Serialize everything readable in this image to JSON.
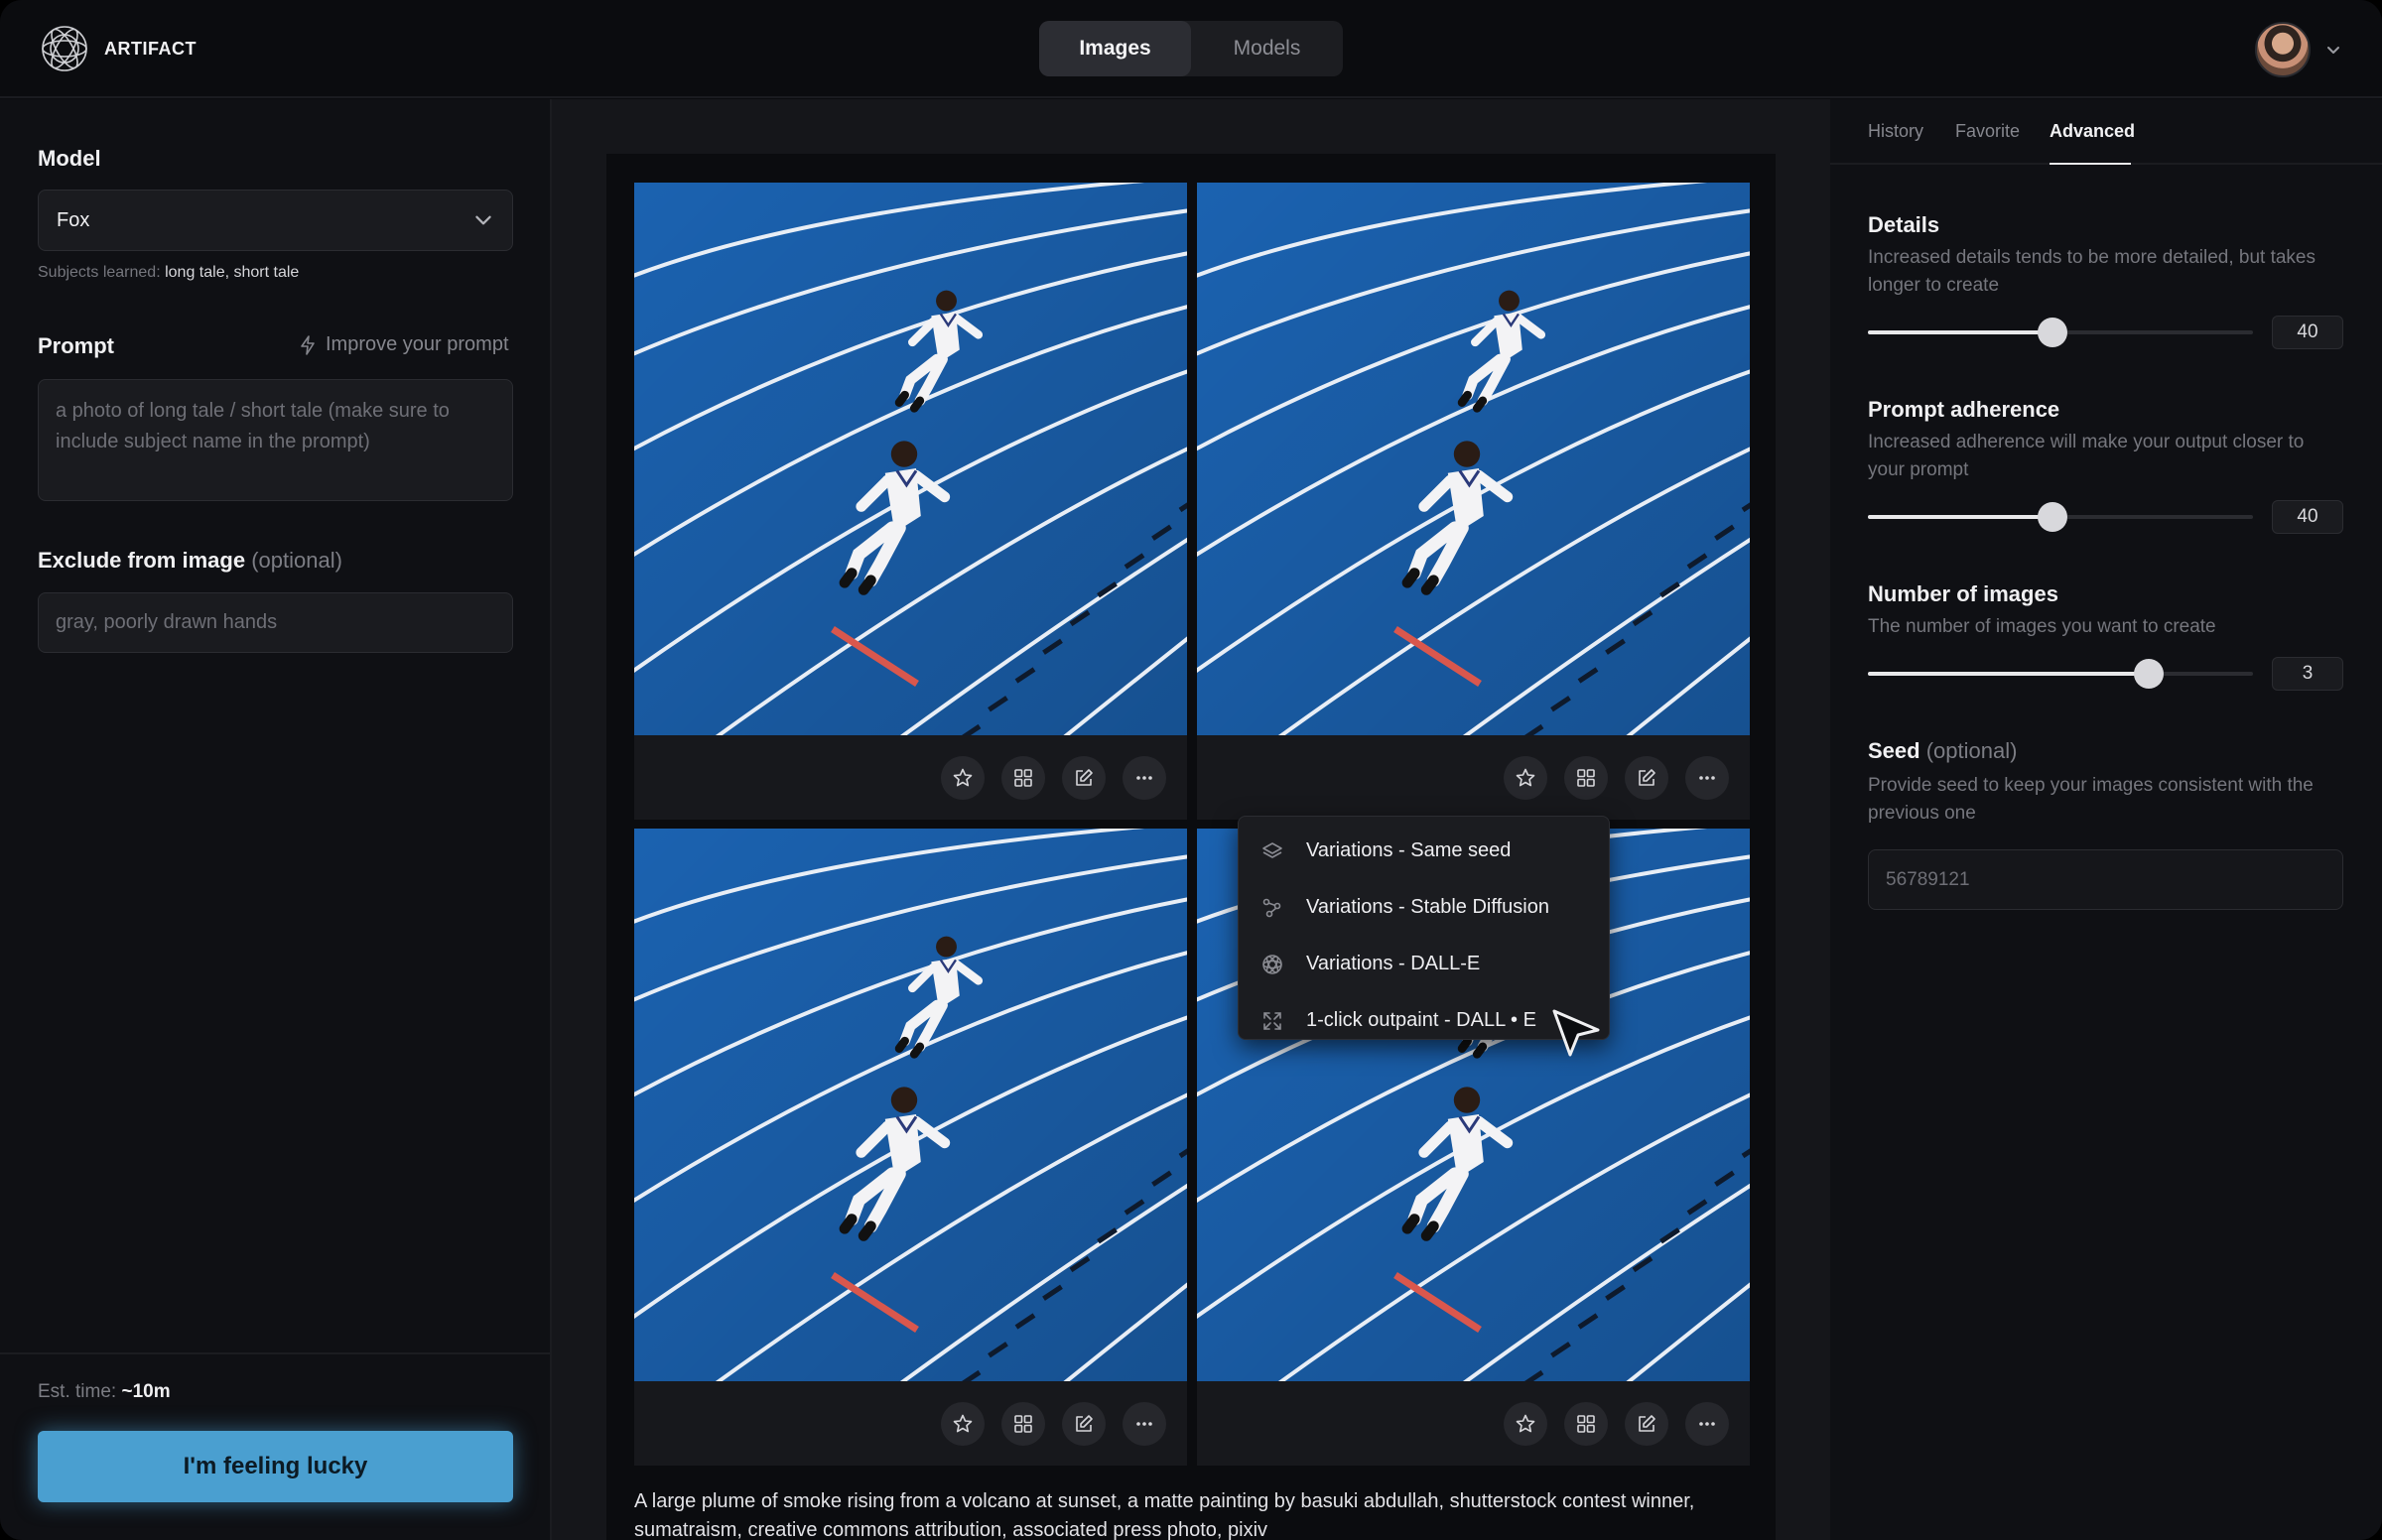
{
  "app": {
    "brand": "ARTIFACT"
  },
  "header": {
    "tabs": [
      {
        "label": "Images",
        "active": true
      },
      {
        "label": "Models",
        "active": false
      }
    ]
  },
  "sidebar": {
    "model_label": "Model",
    "model_value": "Fox",
    "subjects_prefix": "Subjects learned:",
    "subjects_value": "long tale, short tale",
    "prompt_label": "Prompt",
    "improve_label": "Improve your prompt",
    "prompt_placeholder": "a photo of long tale / short tale (make sure to include subject name in the prompt)",
    "exclude_label": "Exclude from image",
    "exclude_optional": "(optional)",
    "exclude_placeholder": "gray, poorly drawn hands",
    "est_prefix": "Est. time:",
    "est_value": "~10m",
    "lucky_button": "I'm feeling lucky"
  },
  "gallery": {
    "caption": "A large plume of smoke rising from a volcano at sunset, a matte painting by basuki abdullah, shutterstock contest winner, sumatraism, creative commons attribution, associated press photo, pixiv",
    "image_actions": [
      "star-icon",
      "grid-icon",
      "edit-icon",
      "more-icon"
    ],
    "menu_items": [
      {
        "label": "Variations - Same seed",
        "icon": "layers-icon"
      },
      {
        "label": "Variations - Stable Diffusion",
        "icon": "nodes-icon"
      },
      {
        "label": "Variations - DALL-E",
        "icon": "openai-icon"
      },
      {
        "label": "1-click outpaint - DALL • E",
        "icon": "expand-icon"
      }
    ]
  },
  "right_panel": {
    "tabs": [
      {
        "label": "History",
        "active": false
      },
      {
        "label": "Favorite",
        "active": false
      },
      {
        "label": "Advanced",
        "active": true
      }
    ],
    "details": {
      "label": "Details",
      "desc": "Increased details tends to be more detailed, but takes longer to create",
      "value": "40",
      "level": 0.48
    },
    "adherence": {
      "label": "Prompt adherence",
      "desc": "Increased adherence will make your output closer to your prompt",
      "value": "40",
      "level": 0.48
    },
    "num_images": {
      "label": "Number of images",
      "desc": "The number of images you want to create",
      "value": "3",
      "level": 0.73
    },
    "seed": {
      "label": "Seed",
      "optional": "(optional)",
      "desc": "Provide seed to keep your images consistent with the previous one",
      "placeholder": "56789121"
    }
  },
  "colors": {
    "accent": "#4a9fd0",
    "track_blue": "#1b62b0",
    "background": "#0b0c0f"
  }
}
